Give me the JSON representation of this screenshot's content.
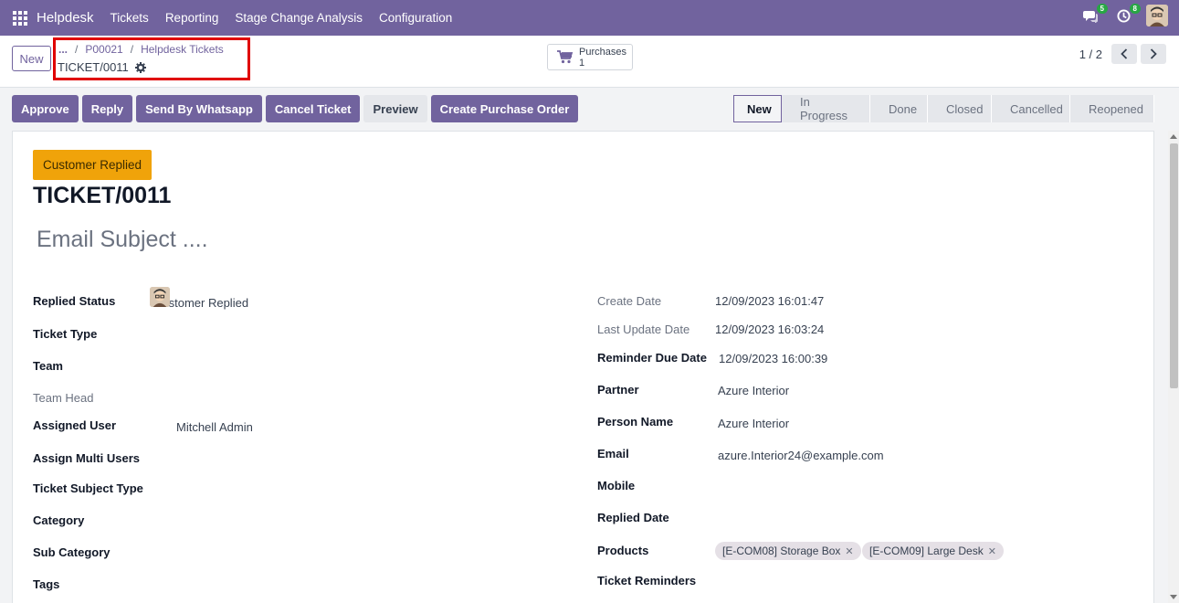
{
  "nav": {
    "brand": "Helpdesk",
    "menus": [
      "Tickets",
      "Reporting",
      "Stage Change Analysis",
      "Configuration"
    ],
    "messages_badge": "5",
    "activity_badge": "8"
  },
  "control": {
    "new_label": "New",
    "breadcrumb": {
      "ellipsis": "...",
      "item1": "P00021",
      "item2": "Helpdesk Tickets",
      "current": "TICKET/0011"
    },
    "smart_button": {
      "label": "Purchases",
      "count": "1"
    },
    "pager": "1 / 2"
  },
  "actions": [
    "Approve",
    "Reply",
    "Send By Whatsapp",
    "Cancel Ticket",
    "Preview",
    "Create Purchase Order"
  ],
  "stages": [
    "New",
    "In Progress",
    "Done",
    "Closed",
    "Cancelled",
    "Reopened"
  ],
  "form": {
    "status_tag": "Customer Replied",
    "ticket_name": "TICKET/0011",
    "email_subject_placeholder": "Email Subject ....",
    "left": [
      {
        "label": "Replied Status",
        "value": "Customer Replied"
      },
      {
        "label": "Ticket Type",
        "value": ""
      },
      {
        "label": "Team",
        "value": ""
      },
      {
        "label": "Team Head",
        "value": ""
      },
      {
        "label": "Assigned User",
        "value": "Mitchell Admin"
      },
      {
        "label": "Assign Multi Users",
        "value": ""
      },
      {
        "label": "Ticket Subject Type",
        "value": ""
      },
      {
        "label": "Category",
        "value": ""
      },
      {
        "label": "Sub Category",
        "value": ""
      },
      {
        "label": "Tags",
        "value": ""
      }
    ],
    "right": [
      {
        "label": "Create Date",
        "value": "12/09/2023 16:01:47"
      },
      {
        "label": "Last Update Date",
        "value": "12/09/2023 16:03:24"
      },
      {
        "label": "Reminder Due Date",
        "value": "12/09/2023 16:00:39"
      },
      {
        "label": "Partner",
        "value": "Azure Interior"
      },
      {
        "label": "Person Name",
        "value": "Azure Interior"
      },
      {
        "label": "Email",
        "value": "azure.Interior24@example.com"
      },
      {
        "label": "Mobile",
        "value": ""
      },
      {
        "label": "Replied Date",
        "value": ""
      },
      {
        "label": "Products",
        "value": ""
      },
      {
        "label": "Ticket Reminders",
        "value": ""
      }
    ],
    "products": [
      "[E-COM08] Storage Box",
      "[E-COM09] Large Desk"
    ]
  },
  "colors": {
    "primary": "#71639e",
    "highlight": "#e00000",
    "tag": "#f0a30a"
  }
}
